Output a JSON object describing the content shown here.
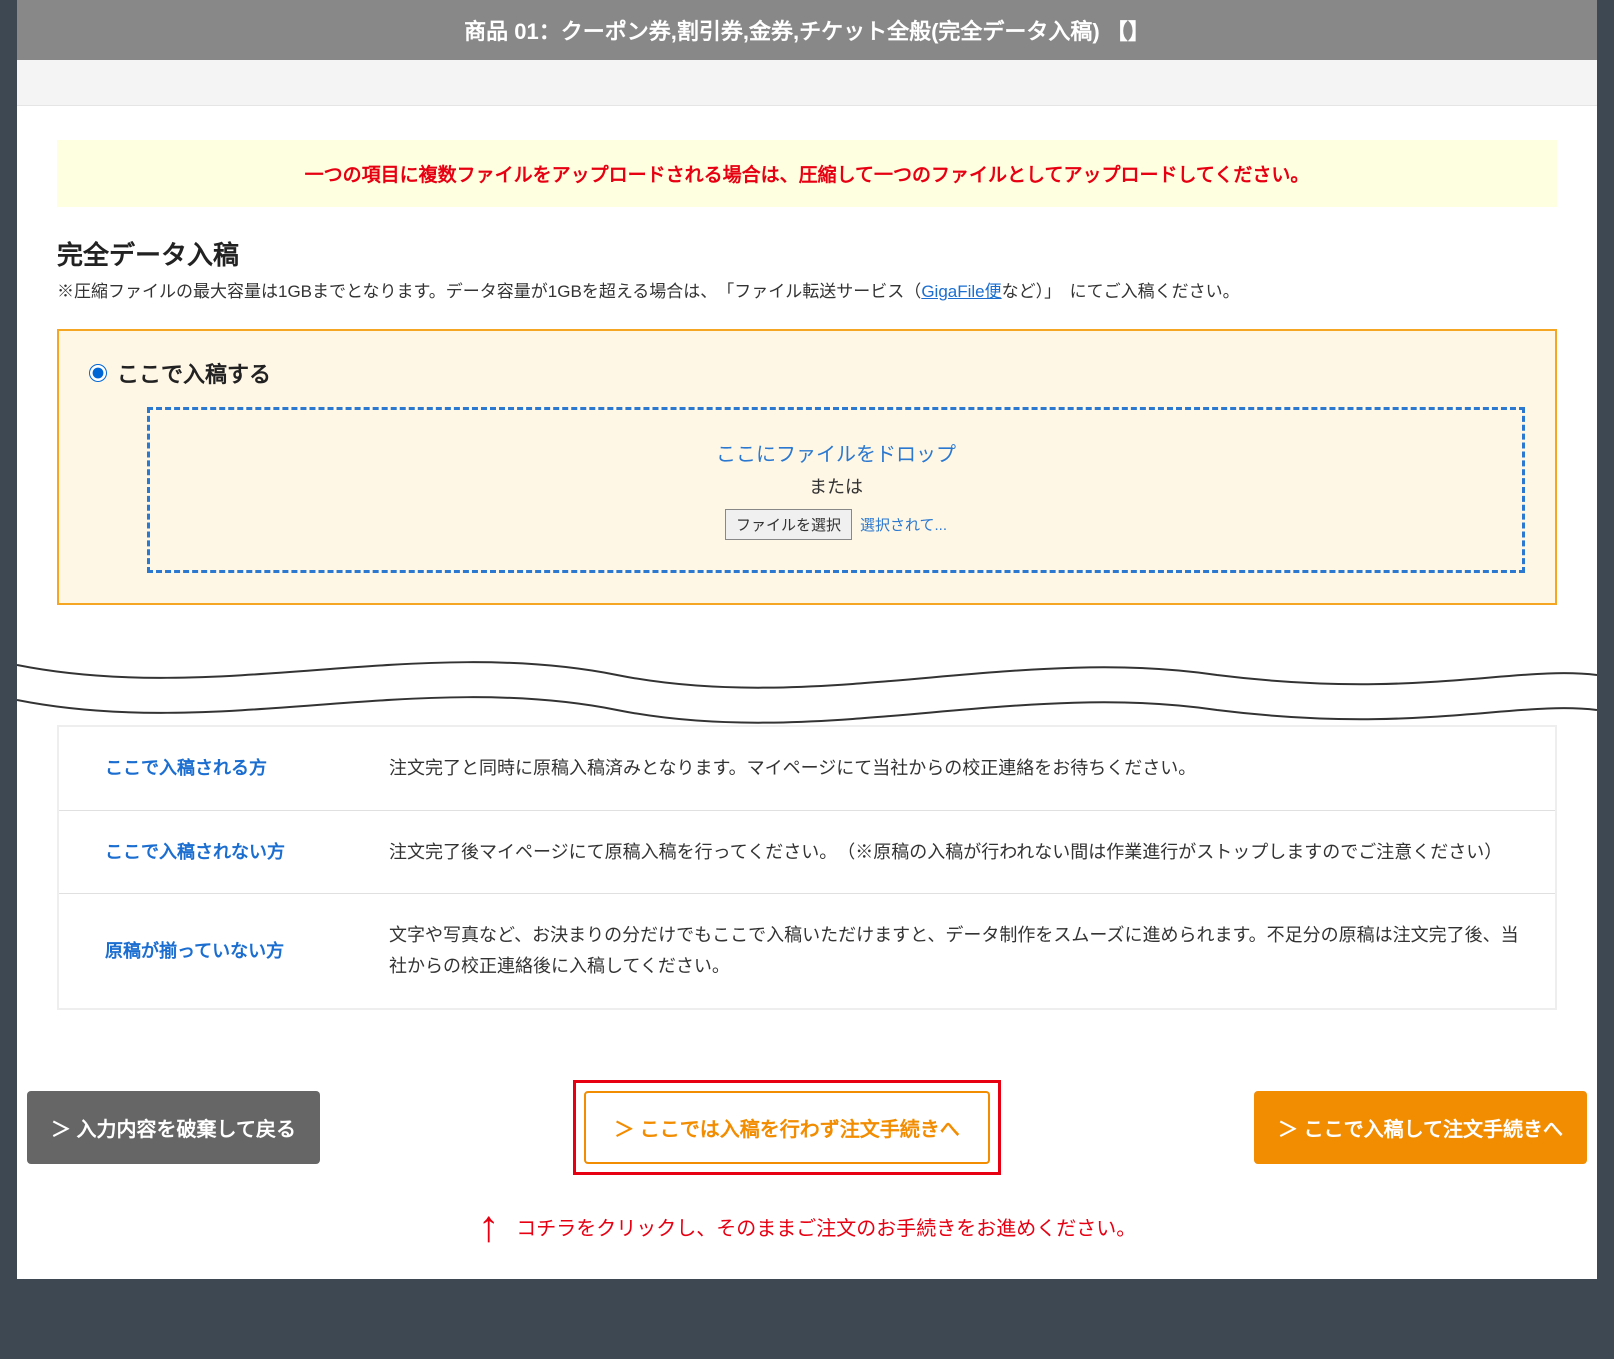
{
  "header": {
    "title": "商品 01：クーポン券,割引券,金券,チケット全般(完全データ入稿) 【】"
  },
  "notice": "一つの項目に複数ファイルをアップロードされる場合は、圧縮して一つのファイルとしてアップロードしてください。",
  "section": {
    "title": "完全データ入稿",
    "desc_pre": "※圧縮ファイルの最大容量は1GBまでとなります。データ容量が1GBを超える場合は、　「ファイル転送サービス（",
    "link_text": "GigaFile便",
    "desc_post": "など）」　にてご入稿ください。"
  },
  "upload": {
    "radio_label": "ここで入稿する",
    "dz_line1": "ここにファイルをドロップ",
    "dz_line2": "または",
    "file_btn": "ファイルを選択",
    "file_status": "選択されて..."
  },
  "info_rows": [
    {
      "label": "ここで入稿される方",
      "text": "注文完了と同時に原稿入稿済みとなります。マイページにて当社からの校正連絡をお待ちください。"
    },
    {
      "label": "ここで入稿されない方",
      "text": "注文完了後マイページにて原稿入稿を行ってください。　（※原稿の入稿が行われない間は作業進行がストップしますのでご注意ください）"
    },
    {
      "label": "原稿が揃っていない方",
      "text": "文字や写真など、お決まりの分だけでもここで入稿いただけますと、データ制作をスムーズに進められます。不足分の原稿は注文完了後、当社からの校正連絡後に入稿してください。"
    }
  ],
  "buttons": {
    "discard": "＞ 入力内容を破棄して戻る",
    "skip": "＞ ここでは入稿を行わず注文手続きへ",
    "proceed": "＞ ここで入稿して注文手続きへ"
  },
  "annotation": "コチラをクリックし、そのままご注文のお手続きをお進めください。"
}
